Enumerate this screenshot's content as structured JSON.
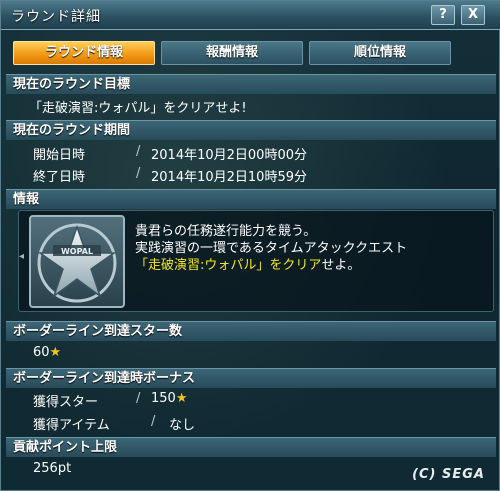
{
  "window": {
    "title": "ラウンド詳細",
    "help_label": "?",
    "close_label": "X"
  },
  "tabs": [
    {
      "label": "ラウンド情報",
      "active": true
    },
    {
      "label": "報酬情報",
      "active": false
    },
    {
      "label": "順位情報",
      "active": false
    }
  ],
  "goal": {
    "heading": "現在のラウンド目標",
    "text": "「走破演習:ウォパル」をクリアせよ!"
  },
  "period": {
    "heading": "現在のラウンド期間",
    "start_label": "開始日時",
    "start_value": "2014年10月2日00時00分",
    "end_label": "終了日時",
    "end_value": "2014年10月2日10時59分",
    "separator": "/"
  },
  "info": {
    "heading": "情報",
    "line1": "貴君らの任務遂行能力を競う。",
    "line2": "実践演習の一環であるタイムアタッククエスト",
    "line3_highlight": "「走破演習:ウォパル」をクリア",
    "line3_rest": "せよ。",
    "emblem_text": "WOPAL"
  },
  "borderline_stars": {
    "heading": "ボーダーライン到達スター数",
    "value": "60"
  },
  "borderline_bonus": {
    "heading": "ボーダーライン到達時ボーナス",
    "stars_label": "獲得スター",
    "stars_value": "150",
    "items_label": "獲得アイテム",
    "items_value": "なし"
  },
  "contribution": {
    "heading": "貢献ポイント上限",
    "value": "256pt"
  },
  "copyright": "(C) SEGA",
  "colors": {
    "accent_tab": "#f39a16",
    "highlight_text": "#f2e623",
    "star": "#f7c21b"
  },
  "icons": [
    "help-icon",
    "close-icon",
    "star-icon",
    "emblem-star-icon"
  ]
}
